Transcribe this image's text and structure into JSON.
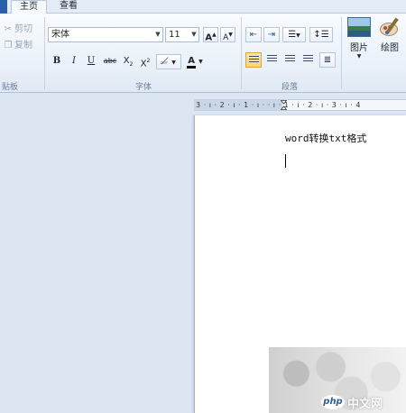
{
  "tabs": {
    "home": "主页",
    "view": "查看"
  },
  "clipboard": {
    "cut": "剪切",
    "copy": "复制",
    "group_label": "贴板"
  },
  "font": {
    "name": "宋体",
    "size": "11",
    "grow": "A",
    "shrink": "A",
    "bold": "B",
    "italic": "I",
    "underline": "U",
    "strike": "abc",
    "subscript_base": "X",
    "subscript_mark": "2",
    "superscript_base": "X",
    "superscript_mark": "2",
    "color_letter": "A",
    "group_label": "字体"
  },
  "paragraph": {
    "group_label": "段落"
  },
  "insert": {
    "picture": "图片",
    "paint": "绘图"
  },
  "ruler": {
    "marks": "3 · ı · 2 · ı · 1 · ı ·  · ı · 1 · ı · 2 · ı · 3 · ı · 4"
  },
  "document": {
    "text": "word转换txt格式"
  },
  "watermark": {
    "logo_text": "php",
    "site_text": "中文网"
  },
  "colors": {
    "accent": "#2b5fa8",
    "ribbon": "#e9f0f8",
    "workspace": "#dce6f3"
  }
}
